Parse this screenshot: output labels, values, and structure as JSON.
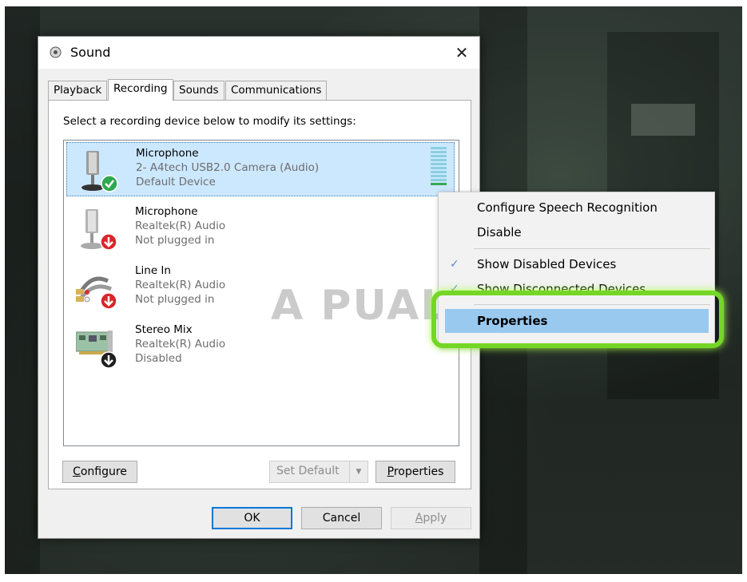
{
  "window": {
    "title": "Sound",
    "close_glyph": "✕"
  },
  "tabs": [
    "Playback",
    "Recording",
    "Sounds",
    "Communications"
  ],
  "active_tab": "Recording",
  "instruction": "Select a recording device below to modify its settings:",
  "devices": [
    {
      "name": "Microphone",
      "line2": "2- A4tech USB2.0 Camera (Audio)",
      "line3": "Default Device",
      "icon": "microphone-icon",
      "status_icon": "default-check-icon",
      "selected": true
    },
    {
      "name": "Microphone",
      "line2": "Realtek(R) Audio",
      "line3": "Not plugged in",
      "icon": "microphone-icon",
      "status_icon": "unplugged-arrow-icon",
      "selected": false
    },
    {
      "name": "Line In",
      "line2": "Realtek(R) Audio",
      "line3": "Not plugged in",
      "icon": "line-in-cable-icon",
      "status_icon": "unplugged-arrow-icon",
      "selected": false
    },
    {
      "name": "Stereo Mix",
      "line2": "Realtek(R) Audio",
      "line3": "Disabled",
      "icon": "sound-card-icon",
      "status_icon": "disabled-arrow-icon",
      "selected": false
    }
  ],
  "level_meter": {
    "bars": 10,
    "active_bars": 1
  },
  "buttons": {
    "configure": {
      "u": "C",
      "rest": "onfigure"
    },
    "set_default": {
      "u": "S",
      "rest": "et Default"
    },
    "properties": {
      "u": "P",
      "rest": "roperties"
    },
    "ok": "OK",
    "cancel": "Cancel",
    "apply": {
      "u": "A",
      "rest": "pply"
    }
  },
  "context_menu": {
    "items": [
      {
        "label": "Configure Speech Recognition",
        "checked": false
      },
      {
        "label": "Disable",
        "checked": false
      },
      {
        "label": "Show Disabled Devices",
        "checked": true
      },
      {
        "label": "Show Disconnected Devices",
        "checked": true
      },
      {
        "label": "Properties",
        "checked": false,
        "highlighted": true
      }
    ],
    "check_glyph": "✓"
  },
  "watermark": "A  PUALS",
  "colors": {
    "selection": "#cce8ff",
    "menu_highlight": "#99c9ef",
    "annotation_ring": "#75d626",
    "default_check": "#2fa84f",
    "unplugged_arrow": "#d9262b"
  }
}
